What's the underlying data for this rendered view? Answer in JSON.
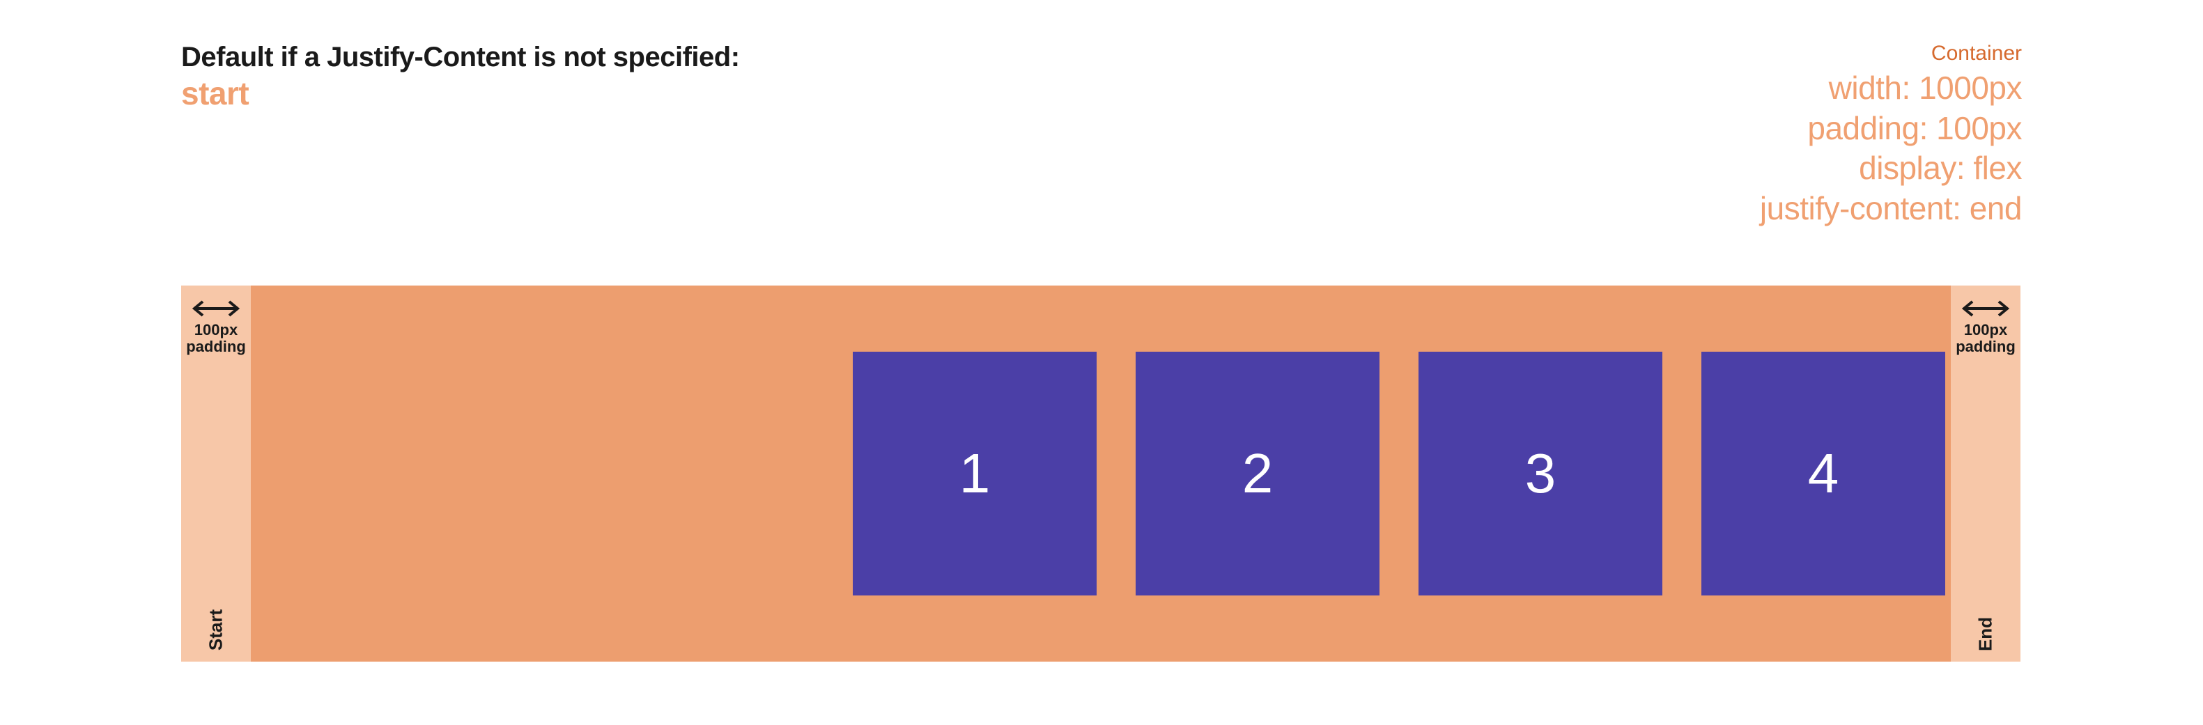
{
  "heading": {
    "title": "Default if a Justify-Content is not specified:",
    "value": "start"
  },
  "container_props": {
    "label": "Container",
    "lines": [
      "width: 1000px",
      "padding: 100px",
      "display: flex",
      "justify-content: end"
    ]
  },
  "demo": {
    "padding_left": {
      "size_label": "100px",
      "label": "padding",
      "side": "Start"
    },
    "padding_right": {
      "size_label": "100px",
      "label": "padding",
      "side": "End"
    },
    "items": [
      "1",
      "2",
      "3",
      "4"
    ]
  },
  "colors": {
    "accent_light": "#f0a071",
    "accent_dark": "#d66a2e",
    "container_bg": "#ed9e6f",
    "padding_bg": "#f7c7a8",
    "item_bg": "#4b3fa7",
    "text": "#1a1a1a"
  }
}
